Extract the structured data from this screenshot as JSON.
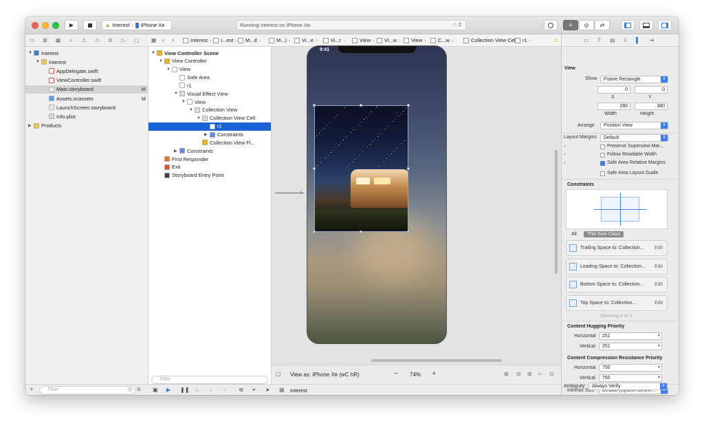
{
  "toolbar": {
    "scheme_target": "Interest",
    "scheme_device": "iPhone Xʀ",
    "activity": "Running Interest on iPhone Xʀ",
    "warnings": "2"
  },
  "navigator": {
    "items": [
      {
        "label": "Interest",
        "indent": 0,
        "disc": "▼",
        "type": "project"
      },
      {
        "label": "Interest",
        "indent": 1,
        "disc": "▼",
        "type": "folder"
      },
      {
        "label": "AppDelegate.swift",
        "indent": 2,
        "disc": "",
        "type": "swift"
      },
      {
        "label": "ViewController.swift",
        "indent": 2,
        "disc": "",
        "type": "swift"
      },
      {
        "label": "Main.storyboard",
        "indent": 2,
        "disc": "",
        "type": "storyboard",
        "badge": "M",
        "selected": true
      },
      {
        "label": "Assets.xcassets",
        "indent": 2,
        "disc": "",
        "type": "assets",
        "badge": "M"
      },
      {
        "label": "LaunchScreen.storyboard",
        "indent": 2,
        "disc": "",
        "type": "storyboard"
      },
      {
        "label": "Info.plist",
        "indent": 2,
        "disc": "",
        "type": "plist"
      },
      {
        "label": "Products",
        "indent": 0,
        "disc": "▶",
        "type": "folder"
      }
    ],
    "filter_placeholder": "Filter"
  },
  "outline": {
    "items": [
      {
        "label": "View Controller Scene",
        "indent": 0,
        "disc": "▼",
        "bold": true,
        "color": "#f4b400"
      },
      {
        "label": "View Controller",
        "indent": 1,
        "disc": "▼",
        "color": "#f4b400"
      },
      {
        "label": "View",
        "indent": 2,
        "disc": "▼",
        "color": "#ffffff"
      },
      {
        "label": "Safe Area",
        "indent": 3,
        "disc": "",
        "color": "#ffffff"
      },
      {
        "label": "r1",
        "indent": 3,
        "disc": "",
        "color": "#ffffff"
      },
      {
        "label": "Visual Effect View",
        "indent": 3,
        "disc": "▼",
        "color": "#dddddd"
      },
      {
        "label": "View",
        "indent": 4,
        "disc": "▼",
        "color": "#ffffff"
      },
      {
        "label": "Collection View",
        "indent": 5,
        "disc": "▼",
        "color": "#dddddd"
      },
      {
        "label": "Collection View Cell",
        "indent": 6,
        "disc": "▼",
        "color": "#dddddd"
      },
      {
        "label": "r1",
        "indent": 7,
        "disc": "",
        "color": "#ffffff",
        "selected": true
      },
      {
        "label": "Constraints",
        "indent": 7,
        "disc": "▶",
        "color": "#5b8def"
      },
      {
        "label": "Collection View Fl...",
        "indent": 6,
        "disc": "",
        "color": "#f4b400"
      },
      {
        "label": "Constraints",
        "indent": 3,
        "disc": "▶",
        "color": "#5b8def"
      },
      {
        "label": "First Responder",
        "indent": 1,
        "disc": "",
        "color": "#e8732a"
      },
      {
        "label": "Exit",
        "indent": 1,
        "disc": "",
        "color": "#e8532a"
      },
      {
        "label": "Storyboard Entry Point",
        "indent": 1,
        "disc": "",
        "color": "#444444"
      }
    ],
    "filter_placeholder": "Filter"
  },
  "jumpbar": [
    "Interest",
    "I...est",
    "M...d",
    "M...)",
    "Vi...e",
    "Vi...r",
    "View",
    "Vi...w",
    "View",
    "C...w",
    "Collection View Cell",
    "r1"
  ],
  "canvas": {
    "time": "9:41",
    "view_as": "View as: iPhone Xʀ (wC hR)",
    "zoom": "74%"
  },
  "debug": {
    "target": "Interest"
  },
  "inspector": {
    "section_view": "View",
    "show_label": "Show",
    "show_value": "Frame Rectangle",
    "x": "0",
    "y": "0",
    "x_label": "X",
    "y_label": "Y",
    "width": "280",
    "height": "380",
    "width_label": "Width",
    "height_label": "Height",
    "arrange_label": "Arrange",
    "arrange_value": "Position View",
    "layout_margins_label": "Layout Margins",
    "layout_margins_value": "Default",
    "checks": [
      {
        "label": "Preserve Superview Mar...",
        "on": false
      },
      {
        "label": "Follow Readable Width",
        "on": false
      },
      {
        "label": "Safe Area Relative Margins",
        "on": true
      },
      {
        "label": "Safe Area Layout Guide",
        "on": false
      }
    ],
    "constraints_title": "Constraints",
    "tab_all": "All",
    "tab_size_class": "This Size Class",
    "constraints": [
      {
        "label": "Trailing Space to:  Collection...",
        "edit": "Edit"
      },
      {
        "label": "Leading Space to:  Collection...",
        "edit": "Edit"
      },
      {
        "label": "Bottom Space to:  Collection...",
        "edit": "Edit"
      },
      {
        "label": "Top Space to:  Collection...",
        "edit": "Edit"
      }
    ],
    "showing": "Showing 4 of 4",
    "hugging_title": "Content Hugging Priority",
    "hugging_h_label": "Horizontal",
    "hugging_h": "251",
    "hugging_v_label": "Vertical",
    "hugging_v": "251",
    "compression_title": "Content Compression Resistance Priority",
    "comp_h_label": "Horizontal",
    "comp_h": "750",
    "comp_v_label": "Vertical",
    "comp_v": "750",
    "intrinsic_label": "Intrinsic Size",
    "intrinsic_value": "Default (System Define...",
    "ambiguity_label": "Ambiguity",
    "ambiguity_value": "Always Verify"
  }
}
